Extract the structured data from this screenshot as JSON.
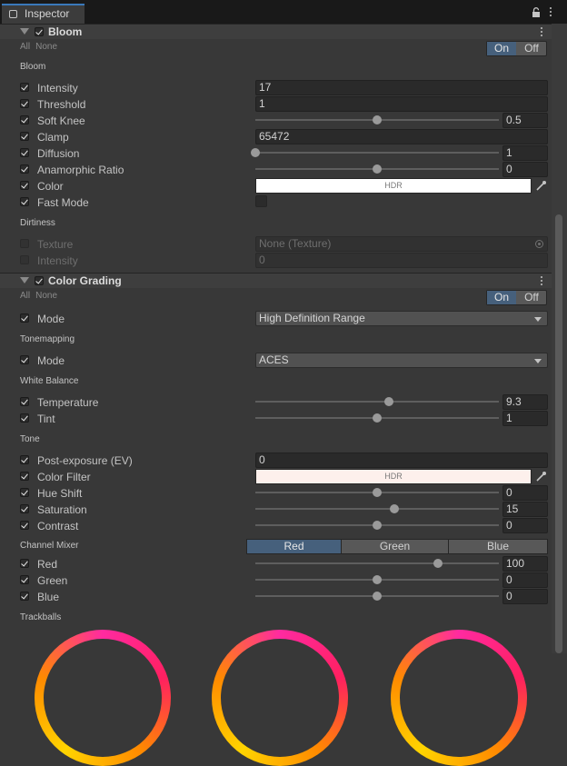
{
  "window": {
    "tab_title": "Inspector"
  },
  "bloom": {
    "title": "Bloom",
    "all_label": "All",
    "none_label": "None",
    "on_label": "On",
    "off_label": "Off",
    "group_bloom": "Bloom",
    "intensity": {
      "label": "Intensity",
      "value": "17"
    },
    "threshold": {
      "label": "Threshold",
      "value": "1"
    },
    "soft_knee": {
      "label": "Soft Knee",
      "value": "0.5",
      "slider_fraction": 0.5
    },
    "clamp": {
      "label": "Clamp",
      "value": "65472"
    },
    "diffusion": {
      "label": "Diffusion",
      "value": "1",
      "slider_fraction": 0.0
    },
    "anamorphic_ratio": {
      "label": "Anamorphic Ratio",
      "value": "0",
      "slider_fraction": 0.5
    },
    "color": {
      "label": "Color",
      "hdr_label": "HDR",
      "swatch": "#ffffff"
    },
    "fast_mode": {
      "label": "Fast Mode",
      "checked": false
    },
    "group_dirtiness": "Dirtiness",
    "texture": {
      "label": "Texture",
      "value": "None (Texture)"
    },
    "dirt_intensity": {
      "label": "Intensity",
      "value": "0"
    }
  },
  "color_grading": {
    "title": "Color Grading",
    "all_label": "All",
    "none_label": "None",
    "on_label": "On",
    "off_label": "Off",
    "mode": {
      "label": "Mode",
      "value": "High Definition Range"
    },
    "group_tonemapping": "Tonemapping",
    "tonemap_mode": {
      "label": "Mode",
      "value": "ACES"
    },
    "group_white_balance": "White Balance",
    "temperature": {
      "label": "Temperature",
      "value": "9.3",
      "slider_fraction": 0.55
    },
    "tint": {
      "label": "Tint",
      "value": "1",
      "slider_fraction": 0.5
    },
    "group_tone": "Tone",
    "post_exposure": {
      "label": "Post-exposure (EV)",
      "value": "0"
    },
    "color_filter": {
      "label": "Color Filter",
      "hdr_label": "HDR",
      "swatch": "#fdf0ec"
    },
    "hue_shift": {
      "label": "Hue Shift",
      "value": "0",
      "slider_fraction": 0.5
    },
    "saturation": {
      "label": "Saturation",
      "value": "15",
      "slider_fraction": 0.57
    },
    "contrast": {
      "label": "Contrast",
      "value": "0",
      "slider_fraction": 0.5
    },
    "group_channel_mixer": "Channel Mixer",
    "mixer_tabs": [
      "Red",
      "Green",
      "Blue"
    ],
    "red": {
      "label": "Red",
      "value": "100",
      "slider_fraction": 0.75
    },
    "green": {
      "label": "Green",
      "value": "0",
      "slider_fraction": 0.5
    },
    "blue": {
      "label": "Blue",
      "value": "0",
      "slider_fraction": 0.5
    },
    "group_trackballs": "Trackballs"
  },
  "colors": {
    "accent": "#46607c",
    "tab_highlight": "#3a79bb",
    "panel": "#383838"
  }
}
